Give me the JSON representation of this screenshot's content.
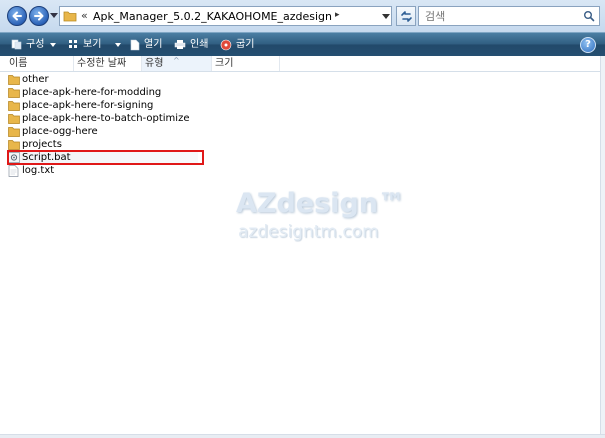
{
  "address": {
    "chevrons": "«",
    "path": "Apk_Manager_5.0.2_KAKAOHOME_azdesign",
    "arrow": "▸"
  },
  "search": {
    "placeholder": "검색"
  },
  "toolbar": {
    "organize": "구성",
    "views": "보기",
    "open": "열기",
    "print": "인쇄",
    "burn": "굽기",
    "help": "?"
  },
  "columns": {
    "name": "이름",
    "modified": "수정한 날짜",
    "type": "유형",
    "size": "크기",
    "sort_indicator": "^"
  },
  "files": [
    {
      "name": "other",
      "kind": "folder"
    },
    {
      "name": "place-apk-here-for-modding",
      "kind": "folder"
    },
    {
      "name": "place-apk-here-for-signing",
      "kind": "folder"
    },
    {
      "name": "place-apk-here-to-batch-optimize",
      "kind": "folder"
    },
    {
      "name": "place-ogg-here",
      "kind": "folder"
    },
    {
      "name": "projects",
      "kind": "folder"
    },
    {
      "name": "Script.bat",
      "kind": "batch",
      "selected": true,
      "highlighted": true
    },
    {
      "name": "log.txt",
      "kind": "text"
    }
  ],
  "watermark": {
    "title": "AZdesign™",
    "url": "azdesigntm.com"
  },
  "colors": {
    "toolbar": "#2f5d80",
    "highlight": "#e01818",
    "folder": "#e8b64a"
  }
}
